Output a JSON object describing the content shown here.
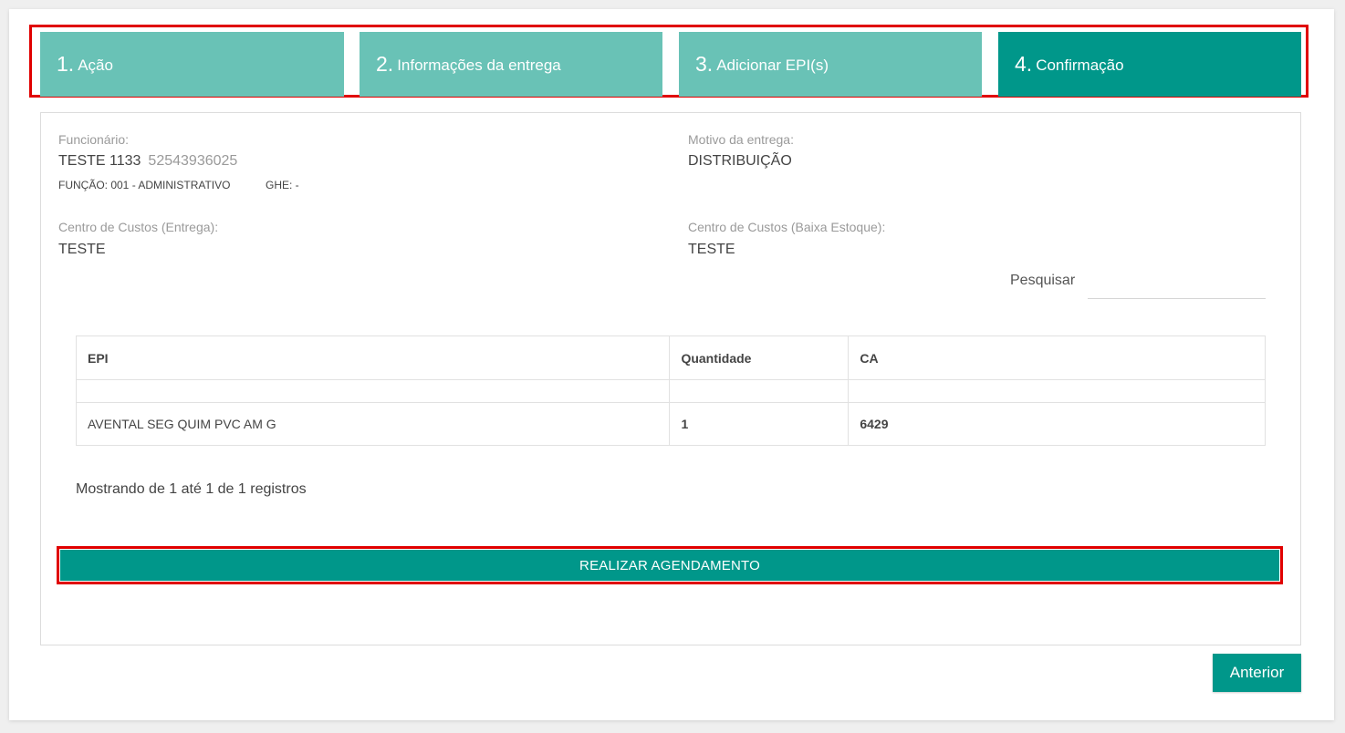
{
  "wizard": {
    "steps": [
      {
        "number": "1.",
        "label": "Ação",
        "active": false
      },
      {
        "number": "2.",
        "label": "Informações da entrega",
        "active": false
      },
      {
        "number": "3.",
        "label": "Adicionar EPI(s)",
        "active": false
      },
      {
        "number": "4.",
        "label": "Confirmação",
        "active": true
      }
    ]
  },
  "employee": {
    "label": "Funcionário:",
    "name": "TESTE 1133",
    "document": "52543936025",
    "function": "FUNÇÃO: 001 - ADMINISTRATIVO",
    "ghe": "GHE: -"
  },
  "delivery_reason": {
    "label": "Motivo da entrega:",
    "value": "DISTRIBUIÇÃO"
  },
  "cost_center_delivery": {
    "label": "Centro de Custos (Entrega):",
    "value": "TESTE"
  },
  "cost_center_stock": {
    "label": "Centro de Custos (Baixa Estoque):",
    "value": "TESTE"
  },
  "search": {
    "label": "Pesquisar",
    "value": ""
  },
  "table": {
    "headers": [
      "EPI",
      "Quantidade",
      "CA"
    ],
    "rows": [
      [
        "AVENTAL SEG QUIM PVC AM G",
        "1",
        "6429"
      ]
    ]
  },
  "records_info": "Mostrando de 1 até 1 de 1 registros",
  "actions": {
    "schedule": "REALIZAR AGENDAMENTO",
    "previous": "Anterior"
  },
  "colors": {
    "step_inactive": "#69c2b6",
    "step_active": "#00978a",
    "primary": "#00978a",
    "highlight_outline": "#e00000"
  }
}
